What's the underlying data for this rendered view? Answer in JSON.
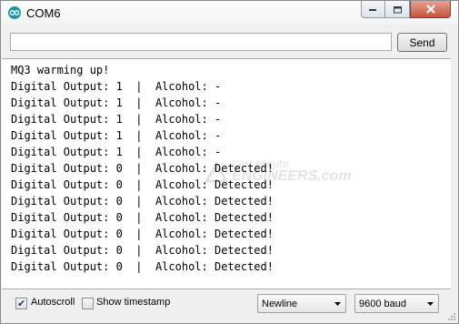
{
  "window": {
    "title": "COM6",
    "accent": "#1a9aa0",
    "close_color": "#c8523c"
  },
  "send_bar": {
    "input_value": "",
    "send_label": "Send"
  },
  "output": {
    "lines": [
      "MQ3 warming up!",
      "Digital Output: 1  |  Alcohol: -",
      "Digital Output: 1  |  Alcohol: -",
      "Digital Output: 1  |  Alcohol: -",
      "Digital Output: 1  |  Alcohol: -",
      "Digital Output: 1  |  Alcohol: -",
      "Digital Output: 0  |  Alcohol: Detected!",
      "Digital Output: 0  |  Alcohol: Detected!",
      "Digital Output: 0  |  Alcohol: Detected!",
      "Digital Output: 0  |  Alcohol: Detected!",
      "Digital Output: 0  |  Alcohol: Detected!",
      "Digital Output: 0  |  Alcohol: Detected!",
      "Digital Output: 0  |  Alcohol: Detected!"
    ],
    "watermark_line1": "Last Minute",
    "watermark_line2": "ENGINEERS.com"
  },
  "footer": {
    "autoscroll_label": "Autoscroll",
    "autoscroll_checked": true,
    "timestamp_label": "Show timestamp",
    "timestamp_checked": false,
    "line_ending": "Newline",
    "baud_rate": "9600 baud"
  },
  "icons": {
    "app": "arduino-icon",
    "minimize": "minimize-icon",
    "maximize": "maximize-icon",
    "close": "close-icon",
    "dropdown": "chevron-down-icon"
  }
}
